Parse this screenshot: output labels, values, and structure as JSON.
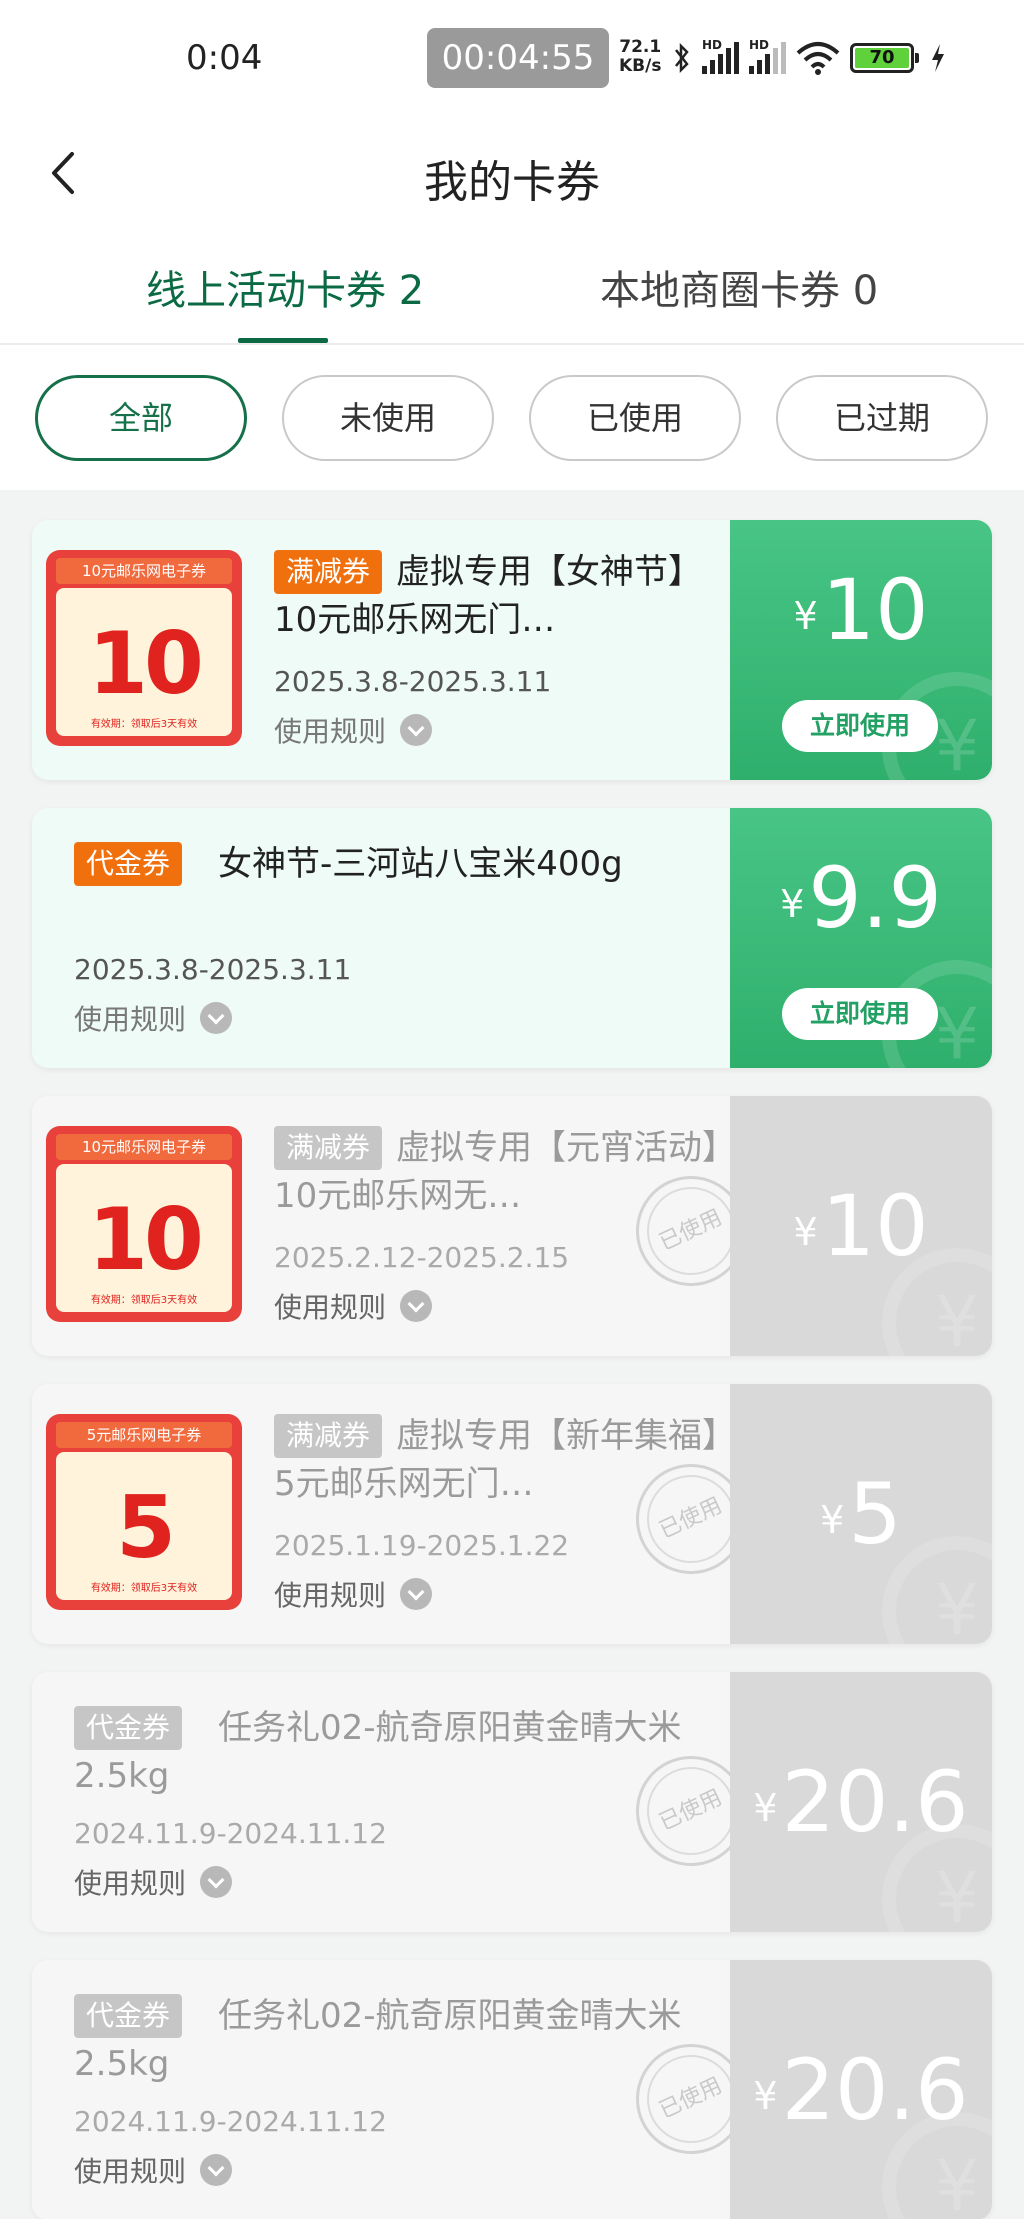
{
  "status_bar": {
    "time": "0:04",
    "recording": "00:04:55",
    "net_speed_value": "72.1",
    "net_speed_unit": "KB/s",
    "battery": "70",
    "signal_label": "HD"
  },
  "nav": {
    "title": "我的卡券"
  },
  "tabs": [
    {
      "label": "线上活动卡券 2",
      "active": true
    },
    {
      "label": "本地商圈卡券 0",
      "active": false
    }
  ],
  "filters": [
    "全部",
    "未使用",
    "已使用",
    "已过期"
  ],
  "currency": "¥",
  "use_button": "立即使用",
  "rule_label": "使用规则",
  "used_stamp": "已使用",
  "cards": [
    {
      "tag": "满减券",
      "title": "虚拟专用【女神节】10元邮乐网无门…",
      "date": "2025.3.8-2025.3.11",
      "price": "10",
      "status": "available",
      "thumb": {
        "header": "10元邮乐网电子券",
        "amount": "10",
        "footer": "有效期：领取后3天有效"
      }
    },
    {
      "tag": "代金券",
      "title": "女神节-三河站八宝米400g",
      "date": "2025.3.8-2025.3.11",
      "price": "9.9",
      "status": "available"
    },
    {
      "tag": "满减券",
      "title": "虚拟专用【元宵活动】10元邮乐网无…",
      "date": "2025.2.12-2025.2.15",
      "price": "10",
      "status": "used",
      "thumb": {
        "header": "10元邮乐网电子券",
        "amount": "10",
        "footer": "有效期：领取后3天有效"
      }
    },
    {
      "tag": "满减券",
      "title": "虚拟专用【新年集福】5元邮乐网无门…",
      "date": "2025.1.19-2025.1.22",
      "price": "5",
      "status": "used",
      "thumb": {
        "header": "5元邮乐网电子券",
        "amount": "5",
        "footer": "有效期：领取后3天有效"
      }
    },
    {
      "tag": "代金券",
      "title": "任务礼02-航奇原阳黄金晴大米2.5kg",
      "date": "2024.11.9-2024.11.12",
      "price": "20.6",
      "status": "used"
    },
    {
      "tag": "代金券",
      "title": "任务礼02-航奇原阳黄金晴大米2.5kg",
      "date": "2024.11.9-2024.11.12",
      "price": "20.6",
      "status": "used"
    }
  ]
}
